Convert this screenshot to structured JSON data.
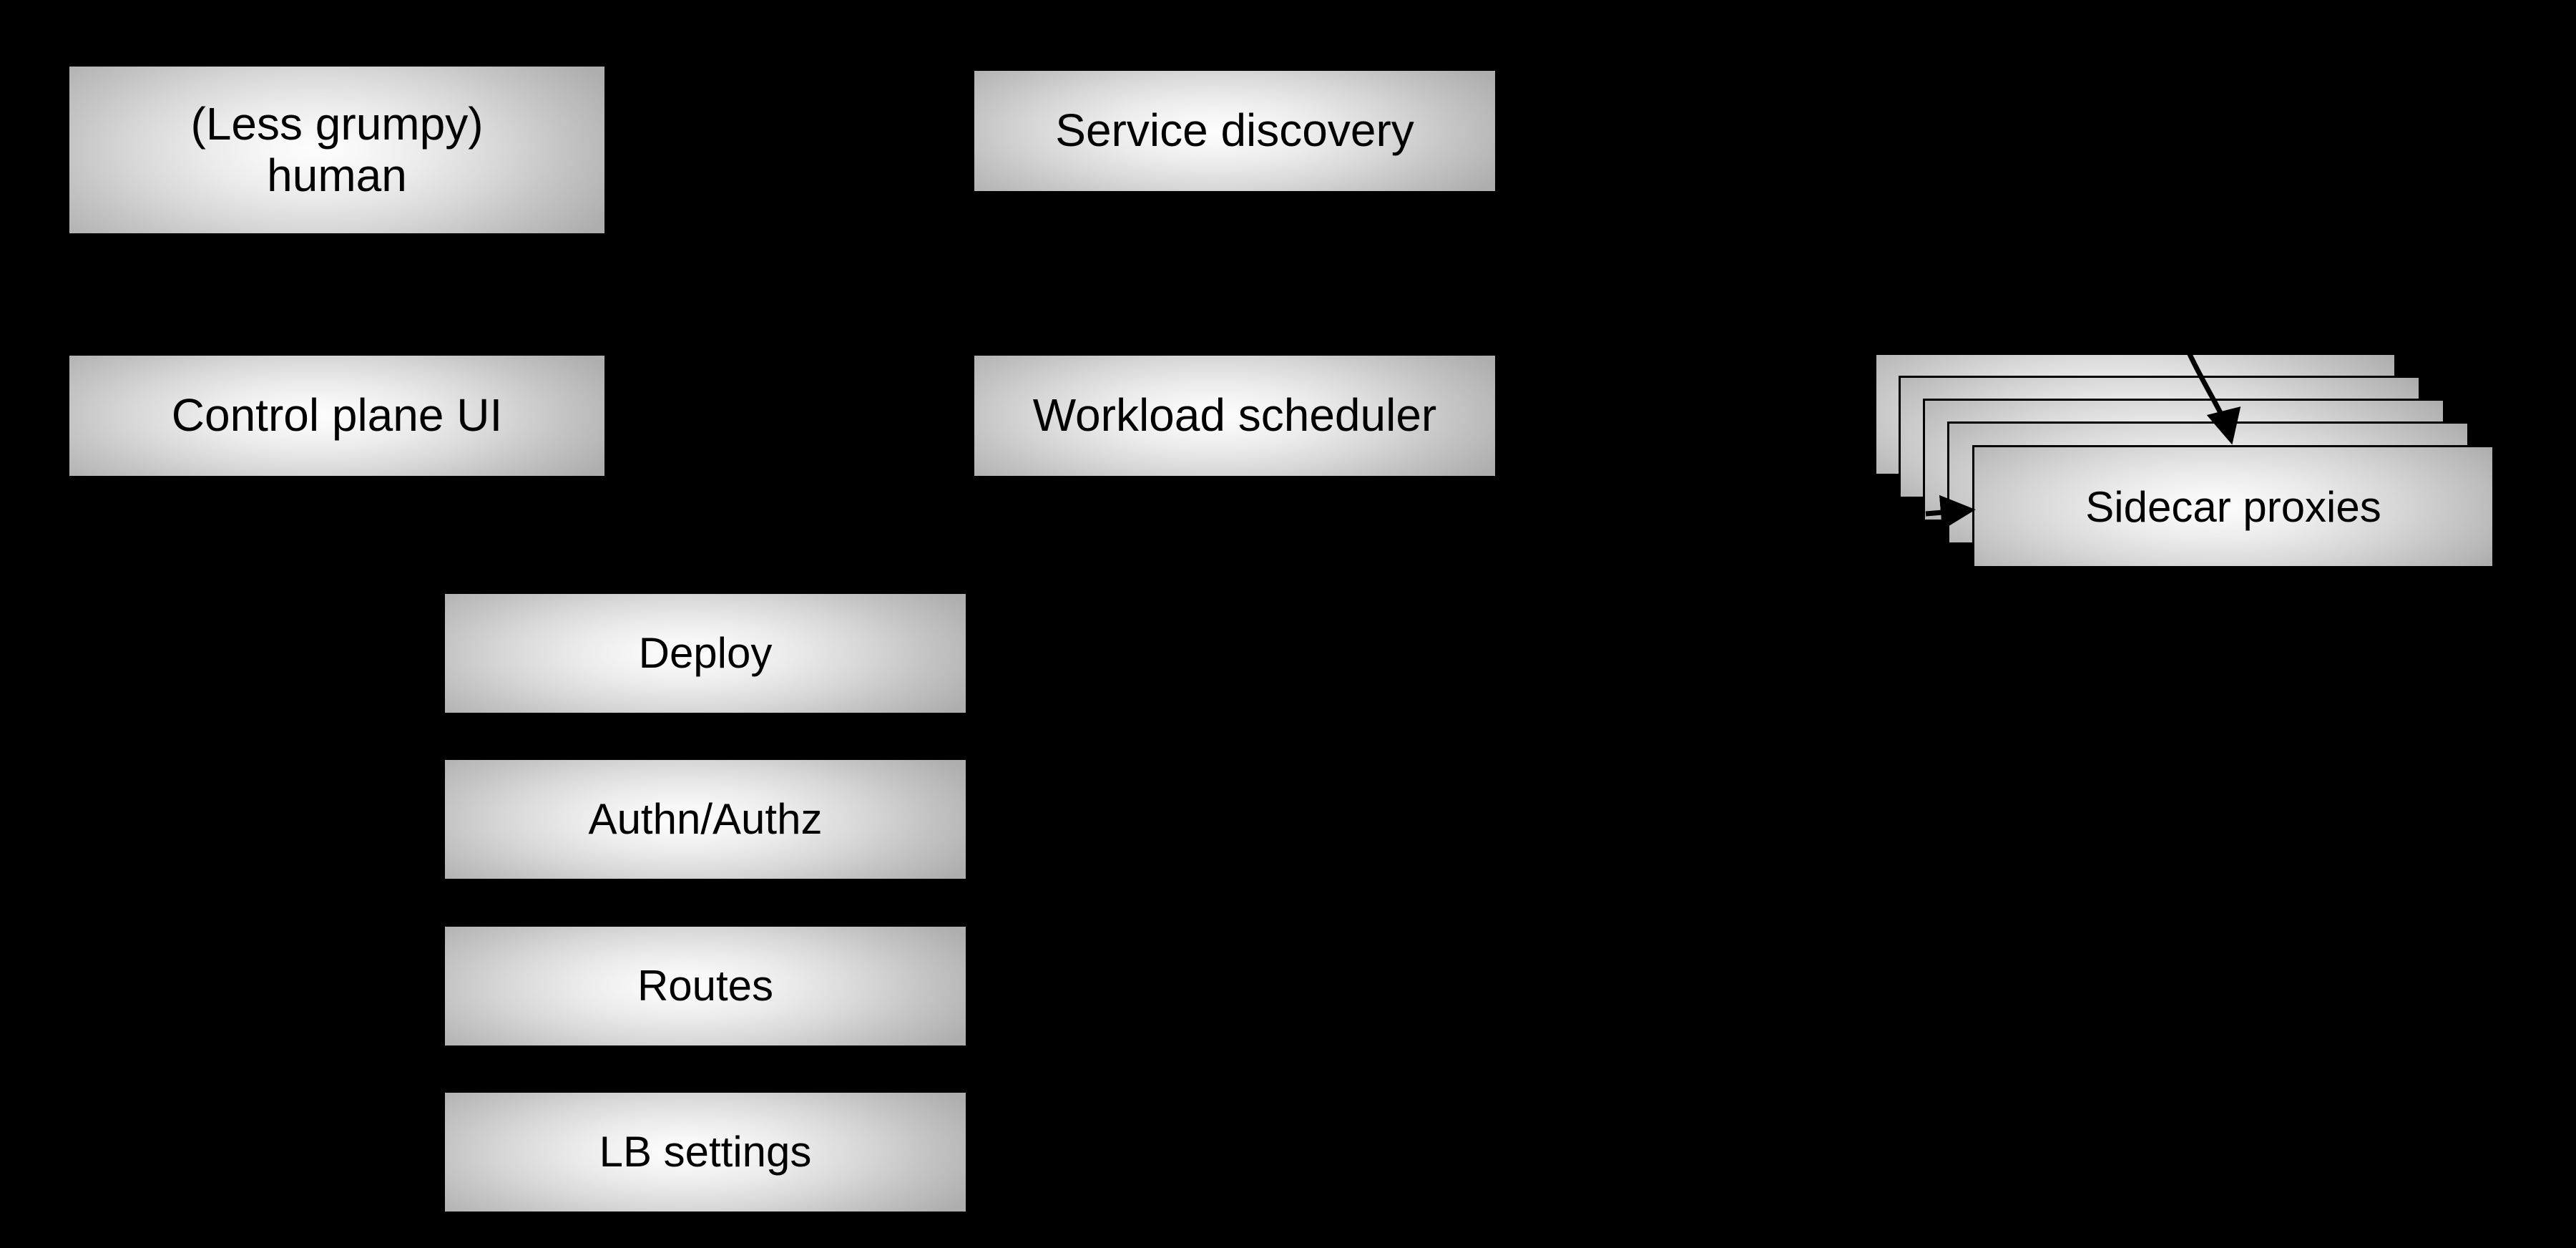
{
  "diagram": {
    "background_color": "#000000",
    "box_fill_light": "#fdfdfd",
    "box_fill_dark": "#aeaeae",
    "text_color": "#000000",
    "border_color": "#000000",
    "boxes": [
      {
        "id": "less-grumpy-human",
        "label": "(Less grumpy)\nhuman"
      },
      {
        "id": "service-discovery",
        "label": "Service discovery"
      },
      {
        "id": "control-plane-ui",
        "label": "Control plane UI"
      },
      {
        "id": "workload-scheduler",
        "label": "Workload scheduler"
      },
      {
        "id": "deploy",
        "label": "Deploy"
      },
      {
        "id": "authn-authz",
        "label": "Authn/Authz"
      },
      {
        "id": "routes",
        "label": "Routes"
      },
      {
        "id": "lb-settings",
        "label": "LB settings"
      }
    ],
    "stack": {
      "id": "sidecar-proxies",
      "label": "Sidecar proxies",
      "count": 5
    },
    "connectors": [
      {
        "id": "curved-into-stack",
        "style": "curved-arrow",
        "direction": "down"
      },
      {
        "id": "into-stack-left",
        "style": "straight-arrow",
        "direction": "right"
      }
    ]
  }
}
